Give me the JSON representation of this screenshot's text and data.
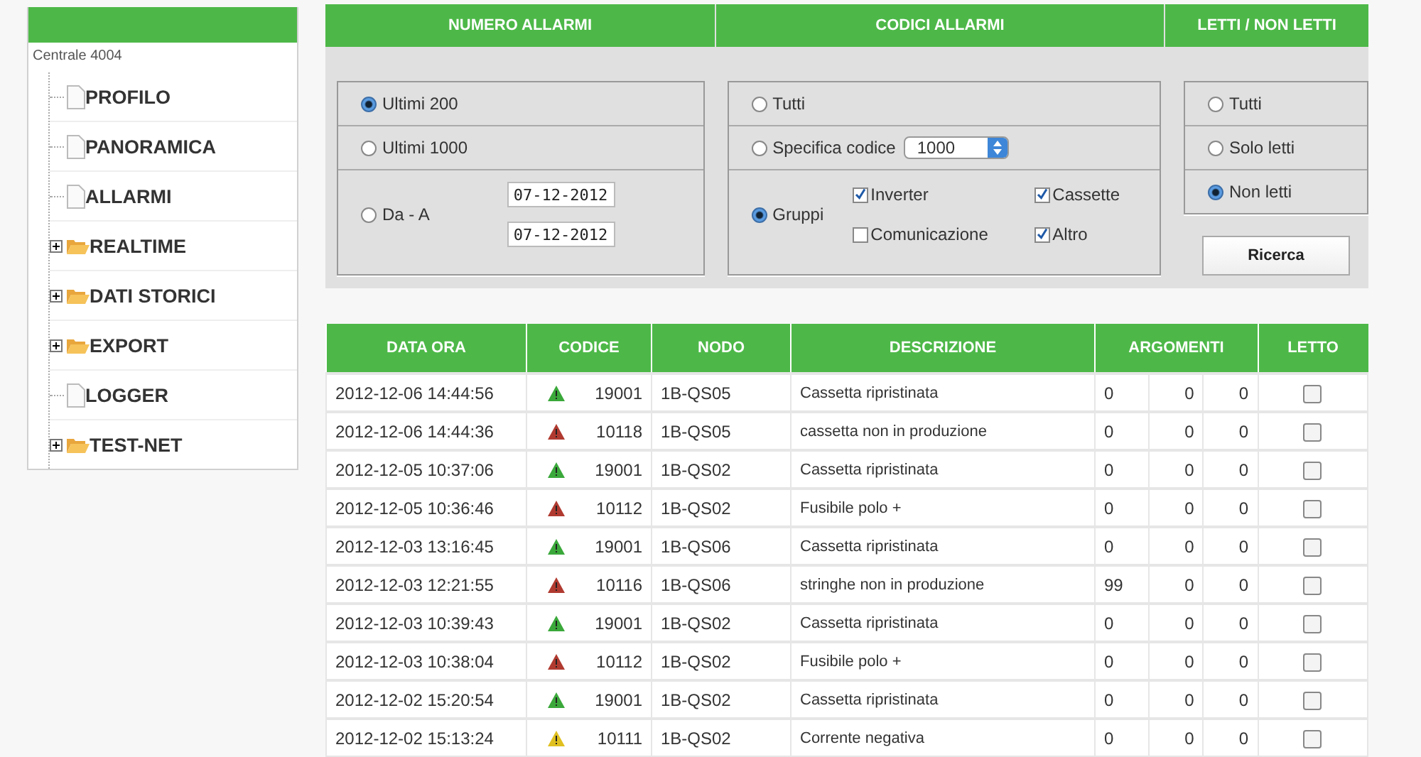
{
  "sidebar": {
    "title": "Centrale 4004",
    "items": [
      {
        "kind": "page",
        "label": "PROFILO"
      },
      {
        "kind": "page",
        "label": "PANORAMICA"
      },
      {
        "kind": "page",
        "label": "ALLARMI"
      },
      {
        "kind": "folder",
        "label": "REALTIME",
        "expanded": false
      },
      {
        "kind": "folder",
        "label": "DATI STORICI",
        "expanded": false
      },
      {
        "kind": "folder",
        "label": "EXPORT",
        "expanded": false
      },
      {
        "kind": "page",
        "label": "LOGGER"
      },
      {
        "kind": "folder",
        "label": "TEST-NET",
        "expanded": false
      }
    ]
  },
  "filters": {
    "headers": [
      "NUMERO ALLARMI",
      "CODICI ALLARMI",
      "LETTI / NON LETTI"
    ],
    "numero": [
      {
        "label": "Ultimi 200",
        "selected": true
      },
      {
        "label": "Ultimi 1000",
        "selected": false
      },
      {
        "label": "Da - A",
        "selected": false
      }
    ],
    "date_from": "07-12-2012",
    "date_to": "07-12-2012",
    "codici": [
      {
        "label": "Tutti",
        "selected": false
      },
      {
        "label": "Specifica codice",
        "selected": false
      },
      {
        "label": "Gruppi",
        "selected": true
      }
    ],
    "code_select": "1000",
    "groups": [
      {
        "label": "Inverter",
        "checked": true
      },
      {
        "label": "Cassette",
        "checked": true
      },
      {
        "label": "Comunicazione",
        "checked": false
      },
      {
        "label": "Altro",
        "checked": true
      }
    ],
    "letti": [
      {
        "label": "Tutti",
        "selected": false
      },
      {
        "label": "Solo letti",
        "selected": false
      },
      {
        "label": "Non letti",
        "selected": true
      }
    ],
    "search_button": "Ricerca"
  },
  "table": {
    "columns": [
      "DATA ORA",
      "CODICE",
      "NODO",
      "DESCRIZIONE",
      "ARGOMENTI",
      "LETTO"
    ],
    "rows": [
      {
        "date": "2012-12-06 14:44:56",
        "color": "#3aa83a",
        "code": "19001",
        "node": "1B-QS05",
        "description": "Cassetta ripristinata",
        "args": [
          "0",
          "0",
          "0"
        ],
        "read": false
      },
      {
        "date": "2012-12-06 14:44:36",
        "color": "#b03a30",
        "code": "10118",
        "node": "1B-QS05",
        "description": "cassetta non in produzione",
        "args": [
          "0",
          "0",
          "0"
        ],
        "read": false
      },
      {
        "date": "2012-12-05 10:37:06",
        "color": "#3aa83a",
        "code": "19001",
        "node": "1B-QS02",
        "description": "Cassetta ripristinata",
        "args": [
          "0",
          "0",
          "0"
        ],
        "read": false
      },
      {
        "date": "2012-12-05 10:36:46",
        "color": "#b03a30",
        "code": "10112",
        "node": "1B-QS02",
        "description": "Fusibile polo +",
        "args": [
          "0",
          "0",
          "0"
        ],
        "read": false
      },
      {
        "date": "2012-12-03 13:16:45",
        "color": "#3aa83a",
        "code": "19001",
        "node": "1B-QS06",
        "description": "Cassetta ripristinata",
        "args": [
          "0",
          "0",
          "0"
        ],
        "read": false
      },
      {
        "date": "2012-12-03 12:21:55",
        "color": "#b03a30",
        "code": "10116",
        "node": "1B-QS06",
        "description": "stringhe non in produzione",
        "args": [
          "99",
          "0",
          "0"
        ],
        "read": false
      },
      {
        "date": "2012-12-03 10:39:43",
        "color": "#3aa83a",
        "code": "19001",
        "node": "1B-QS02",
        "description": "Cassetta ripristinata",
        "args": [
          "0",
          "0",
          "0"
        ],
        "read": false
      },
      {
        "date": "2012-12-03 10:38:04",
        "color": "#b03a30",
        "code": "10112",
        "node": "1B-QS02",
        "description": "Fusibile polo +",
        "args": [
          "0",
          "0",
          "0"
        ],
        "read": false
      },
      {
        "date": "2012-12-02 15:20:54",
        "color": "#3aa83a",
        "code": "19001",
        "node": "1B-QS02",
        "description": "Cassetta ripristinata",
        "args": [
          "0",
          "0",
          "0"
        ],
        "read": false
      },
      {
        "date": "2012-12-02 15:13:24",
        "color": "#e0c020",
        "code": "10111",
        "node": "1B-QS02",
        "description": "Corrente negativa",
        "args": [
          "0",
          "0",
          "0"
        ],
        "read": false
      }
    ]
  }
}
